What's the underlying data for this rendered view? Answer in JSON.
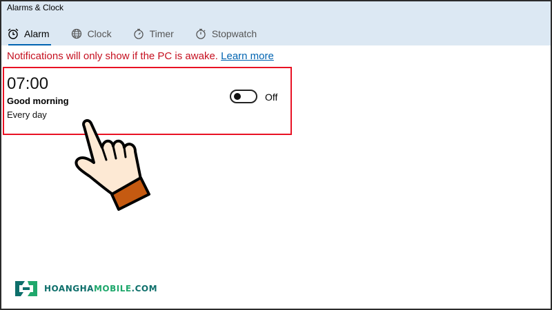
{
  "window": {
    "title": "Alarms & Clock"
  },
  "tabs": [
    {
      "label": "Alarm",
      "icon": "alarm-clock-icon",
      "active": true
    },
    {
      "label": "Clock",
      "icon": "globe-icon",
      "active": false
    },
    {
      "label": "Timer",
      "icon": "timer-icon",
      "active": false
    },
    {
      "label": "Stopwatch",
      "icon": "stopwatch-icon",
      "active": false
    }
  ],
  "notice": {
    "text": "Notifications will only show if the PC is awake.",
    "link": "Learn more"
  },
  "alarm": {
    "time": "07:00",
    "name": "Good morning",
    "repeat": "Every day",
    "toggle_state": "Off"
  },
  "overlay": {
    "icon": "pointing-hand-icon"
  },
  "watermark": {
    "part1": "HOANGHA",
    "part2": "MOBILE",
    "part3": ".COM"
  },
  "colors": {
    "header_bg": "#dce8f3",
    "accent": "#0063b1",
    "notice_red": "#c50f1f",
    "highlight_border": "#e81123"
  }
}
